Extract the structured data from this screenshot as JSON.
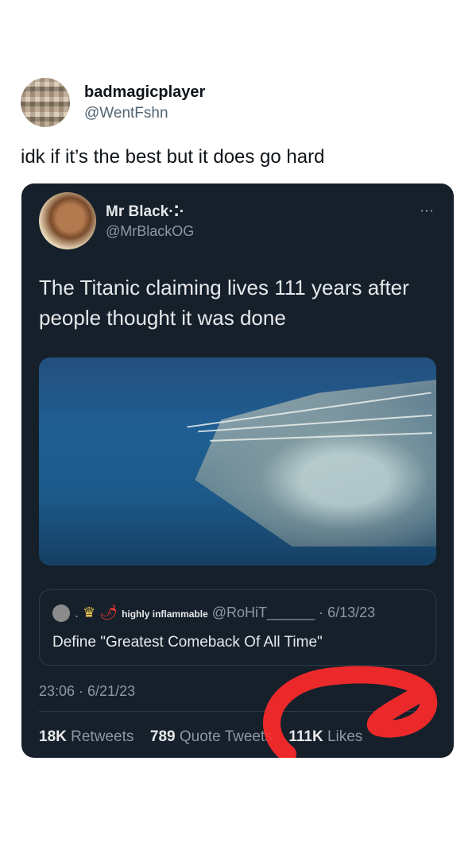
{
  "outer_tweet": {
    "name": "badmagicplayer",
    "handle": "@WentFshn",
    "text": "idk if it’s the best but it does go hard"
  },
  "quoted_tweet": {
    "name": "Mr Black·⁚·",
    "handle": "@MrBlackOG",
    "more_icon": "⋯",
    "text": "The Titanic claiming lives 111 years after people thought it was done",
    "nested_quote": {
      "prefix_dot": ".",
      "crown_icon": "♛",
      "pepper_icon": "🌶",
      "display_name": "highly inflammable",
      "handle": "@RoHiT______",
      "date": "· 6/13/23",
      "text": "Define  \"Greatest Comeback Of All Time\""
    },
    "timestamp": "23:06 · 6/21/23",
    "stats": {
      "retweets_count": "18K",
      "retweets_label": "Retweets",
      "quote_count": "789",
      "quote_label": "Quote Tweets",
      "likes_count": "111K",
      "likes_label": "Likes"
    }
  },
  "colors": {
    "card_bg": "#15202b",
    "scribble": "#ff2a2a"
  }
}
